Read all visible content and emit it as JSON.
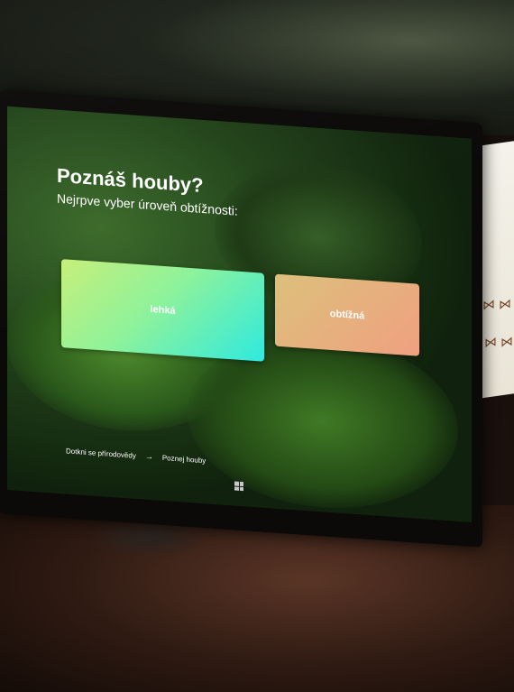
{
  "screen": {
    "title": "Poznáš houby?",
    "subtitle": "Nejrpve vyber úroveň obtížnosti:",
    "buttons": {
      "easy_label": "lehká",
      "hard_label": "obtížná"
    },
    "breadcrumb": {
      "first": "Dotkni se přírodovědy",
      "separator": "→",
      "second": "Poznej houby"
    },
    "colors": {
      "easy_start": "#c6ef7a",
      "easy_end": "#2eeadf",
      "hard_start": "#dcc07c",
      "hard_end": "#f0a080"
    }
  }
}
